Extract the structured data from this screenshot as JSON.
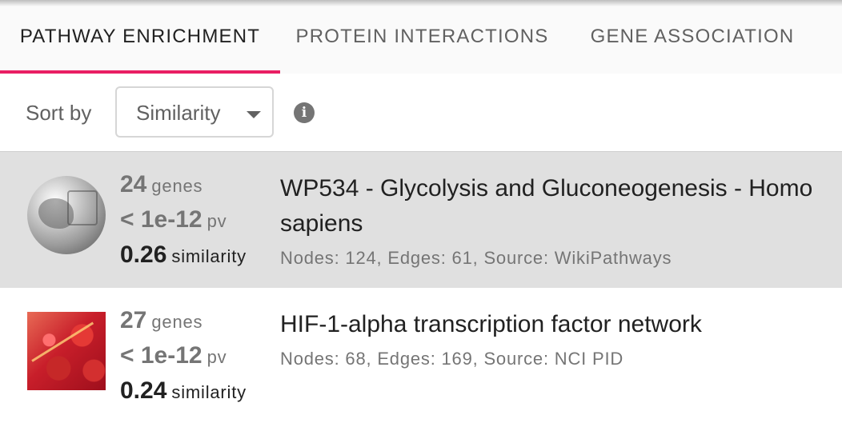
{
  "tabs": [
    {
      "label": "PATHWAY ENRICHMENT",
      "active": true
    },
    {
      "label": "PROTEIN INTERACTIONS",
      "active": false
    },
    {
      "label": "GENE ASSOCIATION",
      "active": false
    }
  ],
  "accent_color": "#e91e63",
  "sort": {
    "label": "Sort by",
    "selected": "Similarity"
  },
  "results": [
    {
      "thumbnail": "wikipathways-globe",
      "genes": "24",
      "genes_unit": "genes",
      "pv": "< 1e-12",
      "pv_unit": "pv",
      "similarity": "0.26",
      "similarity_unit": "similarity",
      "title": "WP534 - Glycolysis and Gluconeogenesis - Homo sapiens",
      "meta": "Nodes: 124, Edges: 61, Source: WikiPathways",
      "selected": true
    },
    {
      "thumbnail": "red-blood-cells",
      "genes": "27",
      "genes_unit": "genes",
      "pv": "< 1e-12",
      "pv_unit": "pv",
      "similarity": "0.24",
      "similarity_unit": "similarity",
      "title": "HIF-1-alpha transcription factor network",
      "meta": "Nodes: 68, Edges: 169, Source: NCI PID",
      "selected": false
    }
  ]
}
